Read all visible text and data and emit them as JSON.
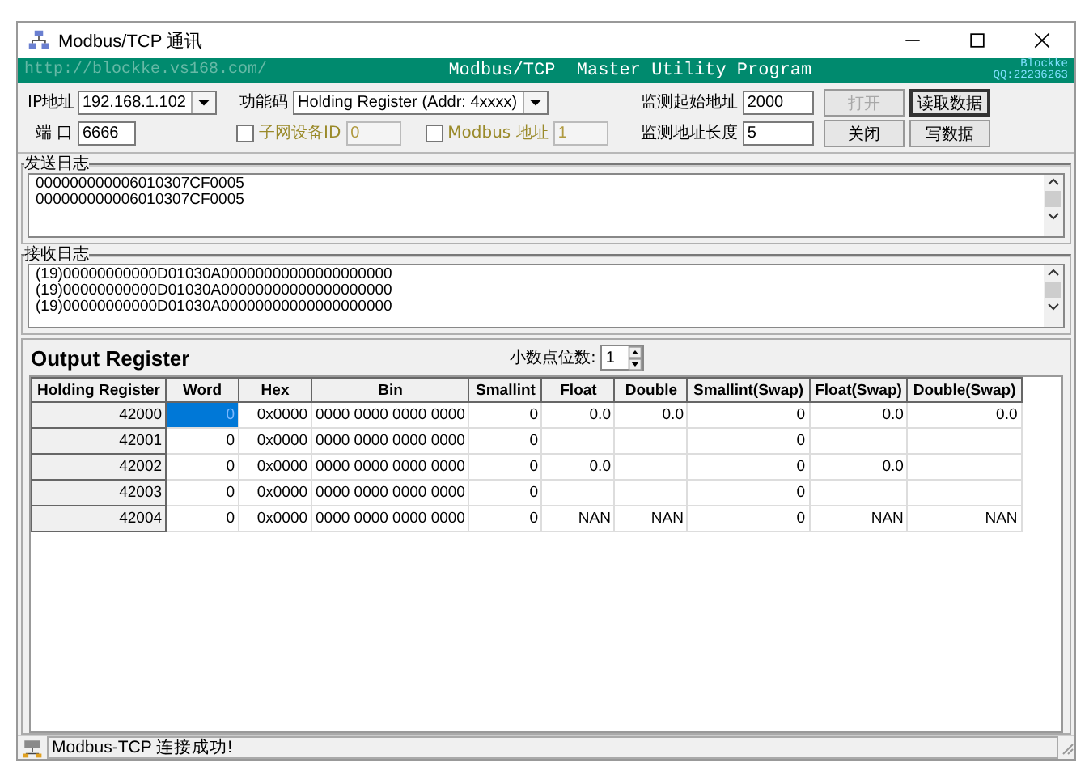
{
  "window": {
    "title": "Modbus/TCP 通讯"
  },
  "banner": {
    "link": "http://blockke.vs168.com/",
    "title": "Modbus/TCP  Master Utility Program",
    "author": "Blockke",
    "qq": "QQ:22236263"
  },
  "connection": {
    "ip_label": "IP地址",
    "ip": "192.168.1.102",
    "port_label": "端 口",
    "port": "6666"
  },
  "function_code": {
    "label": "功能码",
    "value": "Holding Register (Addr: 4xxxx)"
  },
  "subnet_id": {
    "label": "子网设备ID",
    "checked": false,
    "value": "0"
  },
  "modbus_address": {
    "label": "Modbus 地址",
    "checked": false,
    "value": "1"
  },
  "start_address": {
    "label": "监测起始地址",
    "value": "2000"
  },
  "address_length": {
    "label": "监测地址长度",
    "value": "5"
  },
  "buttons": [
    {
      "label": "打开",
      "disabled": true,
      "default": false
    },
    {
      "label": "读取数据",
      "disabled": false,
      "default": true
    },
    {
      "label": "关闭",
      "disabled": false,
      "default": false
    },
    {
      "label": "写数据",
      "disabled": false,
      "default": false
    }
  ],
  "send_log": {
    "title": "发送日志",
    "lines": [
      "000000000006010307CF0005",
      "000000000006010307CF0005"
    ]
  },
  "receive_log": {
    "title": "接收日志",
    "lines": [
      "(19)00000000000D01030A00000000000000000000",
      "(19)00000000000D01030A00000000000000000000",
      "(19)00000000000D01030A00000000000000000000"
    ]
  },
  "output": {
    "title": "Output Register",
    "decimal_label": "小数点位数:",
    "decimal_value": "1"
  },
  "table": {
    "row_header_title": "Holding Register",
    "columns": [
      "Word",
      "Hex",
      "Bin",
      "Smallint",
      "Float",
      "Double",
      "Smallint(Swap)",
      "Float(Swap)",
      "Double(Swap)"
    ],
    "rows": [
      {
        "header": "42000",
        "cells": [
          {
            "text": "0",
            "selected": true
          },
          {
            "text": "0x0000",
            "selected": false
          },
          {
            "text": "0000 0000 0000 0000",
            "selected": false
          },
          {
            "text": "0",
            "selected": false
          },
          {
            "text": "0.0",
            "selected": false
          },
          {
            "text": "0.0",
            "selected": false
          },
          {
            "text": "0",
            "selected": false
          },
          {
            "text": "0.0",
            "selected": false
          },
          {
            "text": "0.0",
            "selected": false
          }
        ]
      },
      {
        "header": "42001",
        "cells": [
          {
            "text": "0",
            "selected": false
          },
          {
            "text": "0x0000",
            "selected": false
          },
          {
            "text": "0000 0000 0000 0000",
            "selected": false
          },
          {
            "text": "0",
            "selected": false
          },
          {
            "selected": false
          },
          {
            "selected": false
          },
          {
            "text": "0",
            "selected": false
          },
          {
            "selected": false
          },
          {
            "selected": false
          }
        ]
      },
      {
        "header": "42002",
        "cells": [
          {
            "text": "0",
            "selected": false
          },
          {
            "text": "0x0000",
            "selected": false
          },
          {
            "text": "0000 0000 0000 0000",
            "selected": false
          },
          {
            "text": "0",
            "selected": false
          },
          {
            "text": "0.0",
            "selected": false
          },
          {
            "selected": false
          },
          {
            "text": "0",
            "selected": false
          },
          {
            "text": "0.0",
            "selected": false
          },
          {
            "selected": false
          }
        ]
      },
      {
        "header": "42003",
        "cells": [
          {
            "text": "0",
            "selected": false
          },
          {
            "text": "0x0000",
            "selected": false
          },
          {
            "text": "0000 0000 0000 0000",
            "selected": false
          },
          {
            "text": "0",
            "selected": false
          },
          {
            "selected": false
          },
          {
            "selected": false
          },
          {
            "text": "0",
            "selected": false
          },
          {
            "selected": false
          },
          {
            "selected": false
          }
        ]
      },
      {
        "header": "42004",
        "cells": [
          {
            "text": "0",
            "selected": false
          },
          {
            "text": "0x0000",
            "selected": false
          },
          {
            "text": "0000 0000 0000 0000",
            "selected": false
          },
          {
            "text": "0",
            "selected": false
          },
          {
            "text": "NAN",
            "selected": false
          },
          {
            "text": "NAN",
            "selected": false
          },
          {
            "text": "0",
            "selected": false
          },
          {
            "text": "NAN",
            "selected": false
          },
          {
            "text": "NAN",
            "selected": false
          }
        ]
      }
    ]
  },
  "status_bar": {
    "text": "Modbus-TCP 连接成功!"
  }
}
